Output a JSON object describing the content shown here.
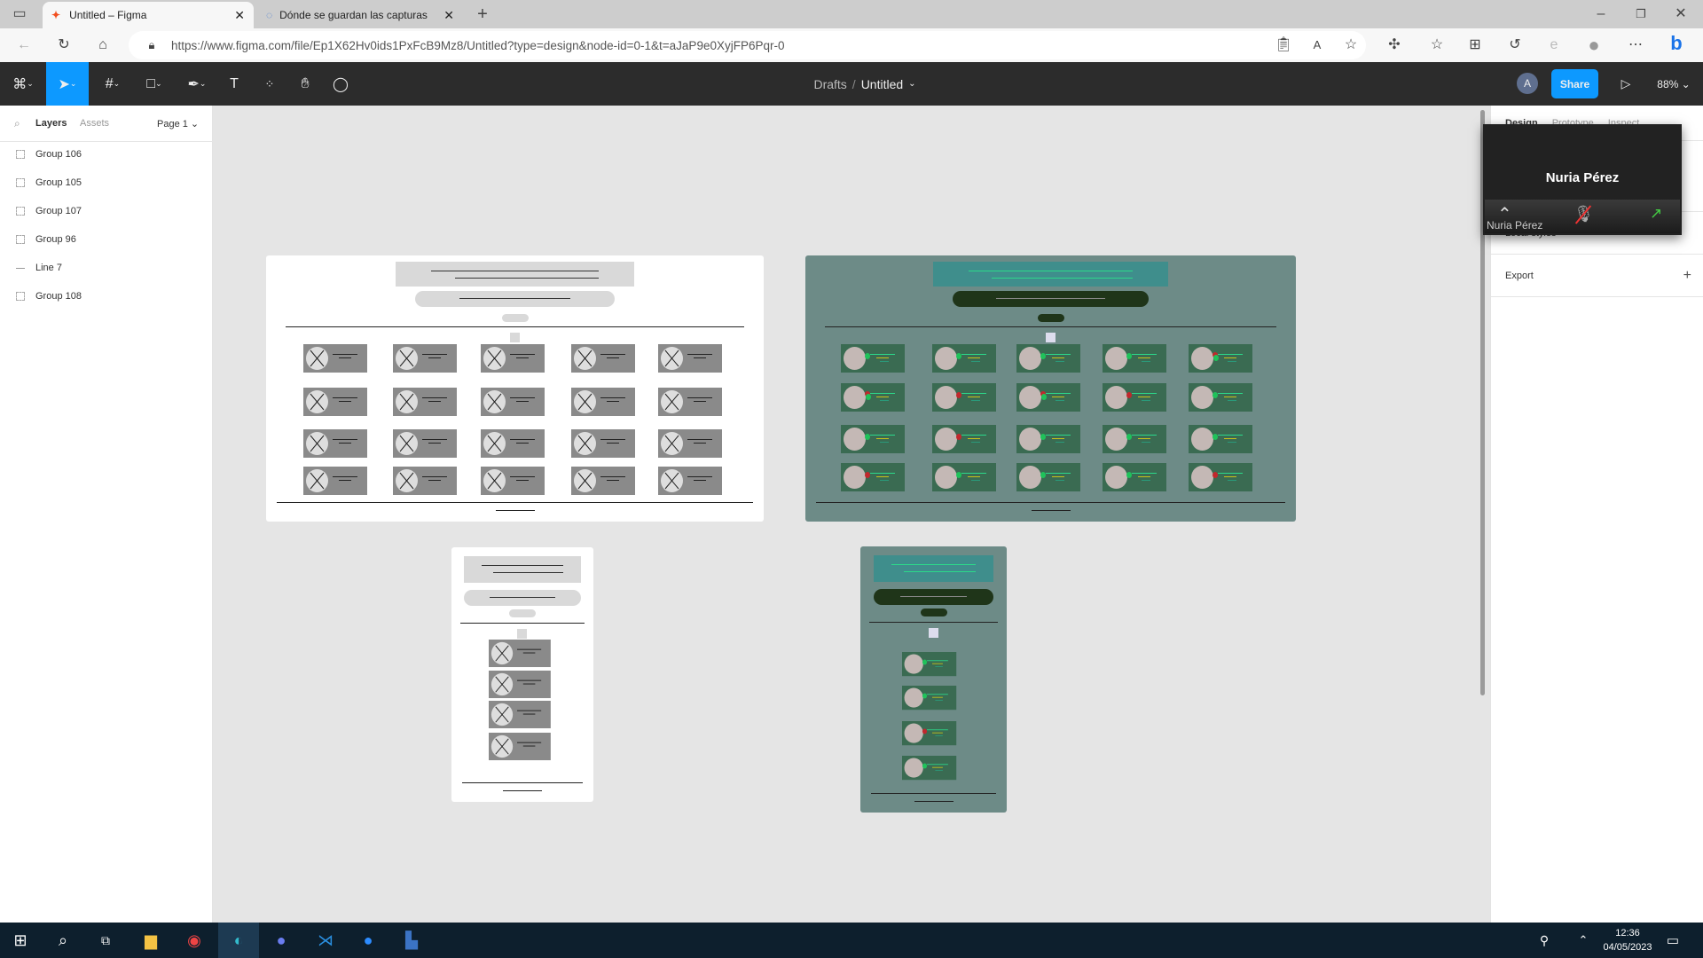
{
  "browser": {
    "tabs": [
      {
        "label": "Untitled – Figma",
        "active": true
      },
      {
        "label": "Dónde se guardan las capturas d",
        "active": false
      }
    ],
    "url": "https://www.figma.com/file/Ep1X62Hv0ids1PxFcB9Mz8/Untitled?type=design&node-id=0-1&t=aJaP9e0XyjFP6Pqr-0"
  },
  "figma": {
    "breadcrumb_root": "Drafts",
    "breadcrumb_sep": "/",
    "file_name": "Untitled",
    "avatar": "A",
    "share_label": "Share",
    "zoom": "88%",
    "left_tabs": {
      "layers": "Layers",
      "assets": "Assets",
      "page": "Page 1"
    },
    "layers": [
      {
        "name": "Group 106",
        "type": "group"
      },
      {
        "name": "Group 105",
        "type": "group"
      },
      {
        "name": "Group 107",
        "type": "group"
      },
      {
        "name": "Group 96",
        "type": "group"
      },
      {
        "name": "Line 7",
        "type": "line"
      },
      {
        "name": "Group 108",
        "type": "group"
      }
    ],
    "right_tabs": [
      "Design",
      "Prototype",
      "Inspect"
    ],
    "local_styles": "Local styles",
    "export": "Export",
    "help": "?"
  },
  "canvas": {
    "frames": [
      {
        "theme": "white",
        "cols": 5,
        "rows": 4
      },
      {
        "theme": "green",
        "cols": 5,
        "rows": 4,
        "status": [
          "green",
          "green",
          "green",
          "green",
          "both",
          "both",
          "red",
          "both",
          "red",
          "green",
          "green",
          "red",
          "green",
          "green",
          "green",
          "red",
          "green",
          "green",
          "green",
          "red"
        ]
      },
      {
        "theme": "white",
        "cols": 1,
        "rows": 4
      },
      {
        "theme": "green",
        "cols": 1,
        "rows": 4,
        "status": [
          "green",
          "green",
          "red",
          "green"
        ]
      }
    ]
  },
  "zoom_overlay": {
    "name": "Nuria Pérez",
    "label": "Nuria Pérez"
  },
  "taskbar": {
    "time": "12:36",
    "date": "04/05/2023"
  },
  "colors": {
    "figma_blue": "#0d99ff",
    "green_frame": "#6d8b87",
    "card_green": "#3a6b52",
    "teal_header": "#3f8e8c",
    "dark_pill": "#1f3519"
  }
}
